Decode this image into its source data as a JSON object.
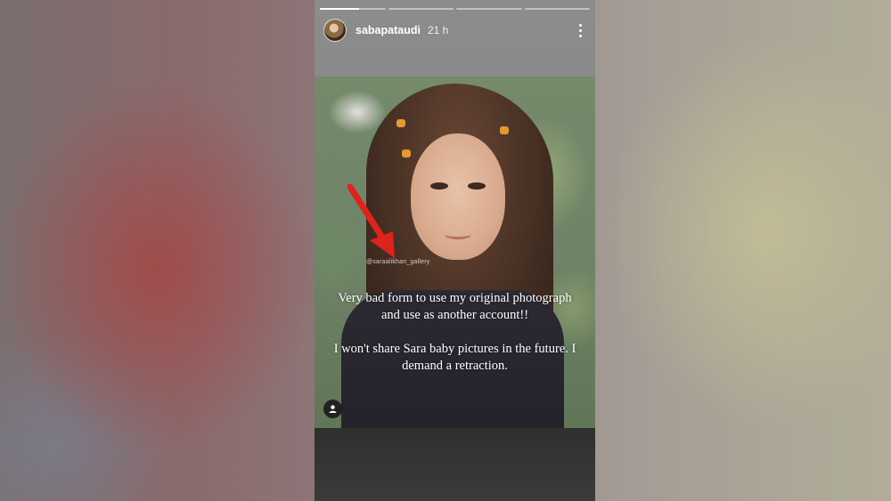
{
  "story": {
    "segments": [
      {
        "progress": 0.6
      },
      {
        "progress": 0
      },
      {
        "progress": 0
      },
      {
        "progress": 0
      }
    ],
    "header": {
      "username": "sabapataudi",
      "timestamp": "21 h",
      "more_icon": "more-vertical-icon"
    },
    "photo": {
      "watermark": "@saraalikhan_gallery"
    },
    "text": {
      "paragraph1": "Very bad form to use my original photograph and use as another account!!",
      "paragraph2": "I won't share Sara baby pictures in the future. I demand a retraction."
    },
    "tag_icon": "user-tag-icon",
    "colors": {
      "arrow": "#e0221c",
      "clip": "#e39a33"
    }
  }
}
